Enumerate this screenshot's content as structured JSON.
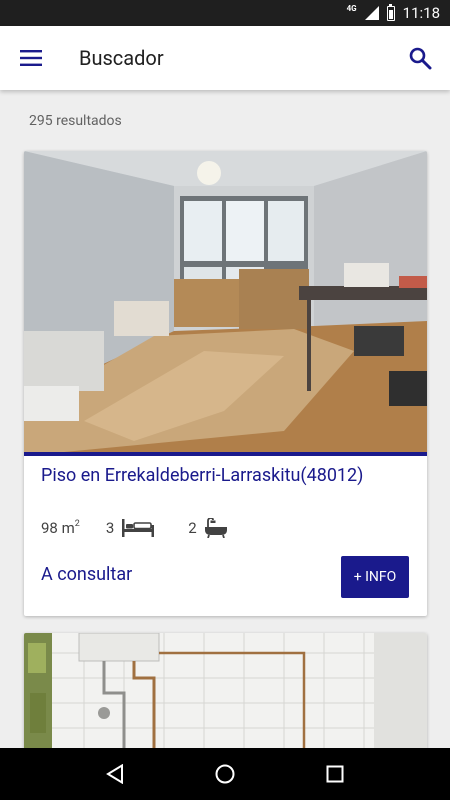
{
  "status_bar": {
    "network": "4G",
    "time": "11:18"
  },
  "app_bar": {
    "title": "Buscador",
    "menu_icon": "hamburger-menu-icon",
    "search_icon": "search-icon"
  },
  "results": {
    "count_label": "295 resultados"
  },
  "listings": [
    {
      "title": "Piso en Errekaldeberri-Larraskitu(48012)",
      "area": "98 m",
      "area_unit_sup": "2",
      "rooms": "3",
      "baths": "2",
      "price": "A consultar",
      "info_button": "+ INFO"
    }
  ],
  "colors": {
    "accent": "#1a1a8c",
    "status_bar": "#1f1f1f",
    "background": "#eeeeee"
  },
  "nav_bar": {
    "back_icon": "back-triangle-icon",
    "home_icon": "home-circle-icon",
    "recents_icon": "recents-square-icon"
  }
}
